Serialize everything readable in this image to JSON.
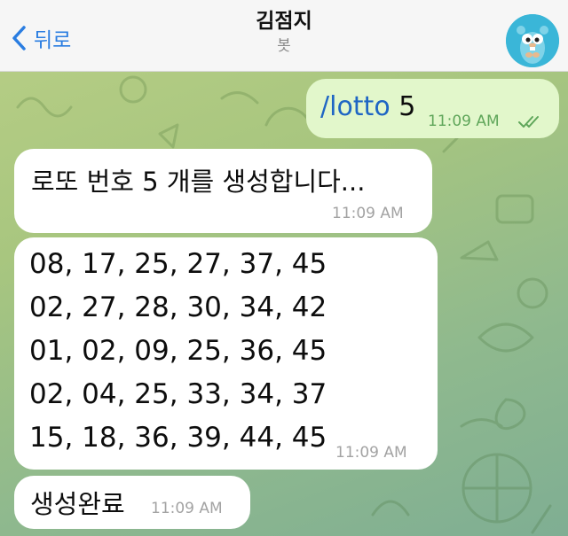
{
  "header": {
    "back_label": "뒤로",
    "title": "김점지",
    "subtitle": "봇"
  },
  "icons": {
    "back": "chevron-left-icon",
    "avatar": "gopher-avatar",
    "read_status": "double-check-icon"
  },
  "colors": {
    "accent": "#2a7de1",
    "outgoing_bubble": "#e2f7cb",
    "incoming_bubble": "#ffffff",
    "command_link": "#1f66c4",
    "outgoing_time": "#5fa65a"
  },
  "messages": {
    "outgoing": {
      "command": "/lotto",
      "arg": " 5",
      "time": "11:09 AM"
    },
    "generating": {
      "text": "로또 번호 5 개를 생성합니다...",
      "time": "11:09 AM"
    },
    "numbers": {
      "lines": [
        "08, 17, 25, 27, 37, 45",
        "02, 27, 28, 30, 34, 42",
        "01, 02, 09, 25, 36, 45",
        "02, 04, 25, 33, 34, 37",
        "15, 18, 36, 39, 44, 45"
      ],
      "time": "11:09 AM"
    },
    "done": {
      "text": "생성완료",
      "time": "11:09 AM"
    }
  }
}
